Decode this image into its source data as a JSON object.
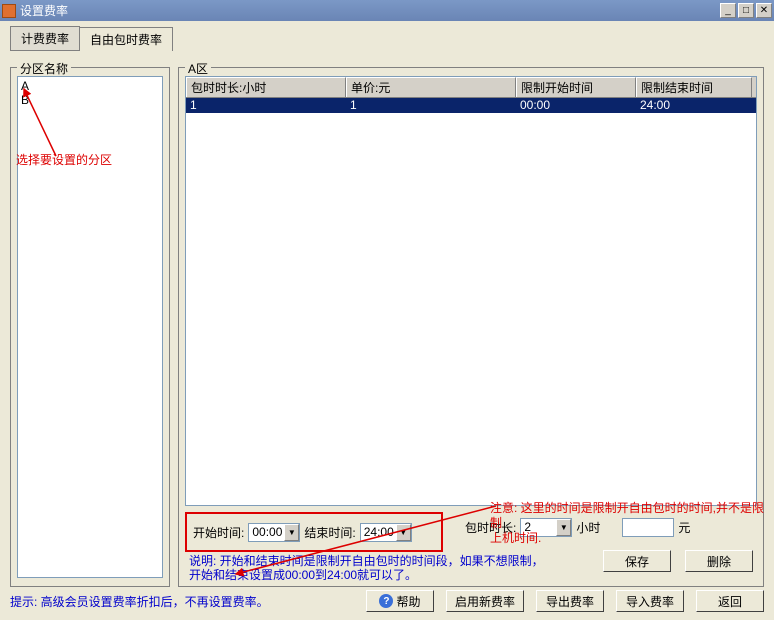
{
  "title": "设置费率",
  "tabs": [
    {
      "label": "计费费率"
    },
    {
      "label": "自由包时费率"
    }
  ],
  "left": {
    "caption": "分区名称",
    "items": [
      "A",
      "B"
    ]
  },
  "anno_left": "选择要设置的分区",
  "right": {
    "caption": "A区",
    "cols": [
      "包时时长:小时",
      "单价:元",
      "限制开始时间",
      "限制结束时间"
    ],
    "rows": [
      {
        "hours": "1",
        "price": "1",
        "start": "00:00",
        "end": "24:00"
      }
    ]
  },
  "anno_right_line1": "注意: 这里的时间是限制开自由包时的时间,并不是限制",
  "anno_right_line2": "上机时间.",
  "form": {
    "start_label": "开始时间:",
    "start_val": "00:00",
    "end_label": "结束时间:",
    "end_val": "24:00",
    "dur_label": "包时时长:",
    "dur_val": "2",
    "dur_unit": "小时",
    "price_unit": "元",
    "explain_line1": "说明: 开始和结束时间是限制开自由包时的时间段，如果不想限制，",
    "explain_line2": "开始和结束设置成00:00到24:00就可以了。"
  },
  "btns": {
    "save": "保存",
    "delete": "删除",
    "help": "帮助",
    "enable": "启用新费率",
    "export": "导出费率",
    "import": "导入费率",
    "back": "返回"
  },
  "tip": "提示: 高级会员设置费率折扣后，不再设置费率。"
}
